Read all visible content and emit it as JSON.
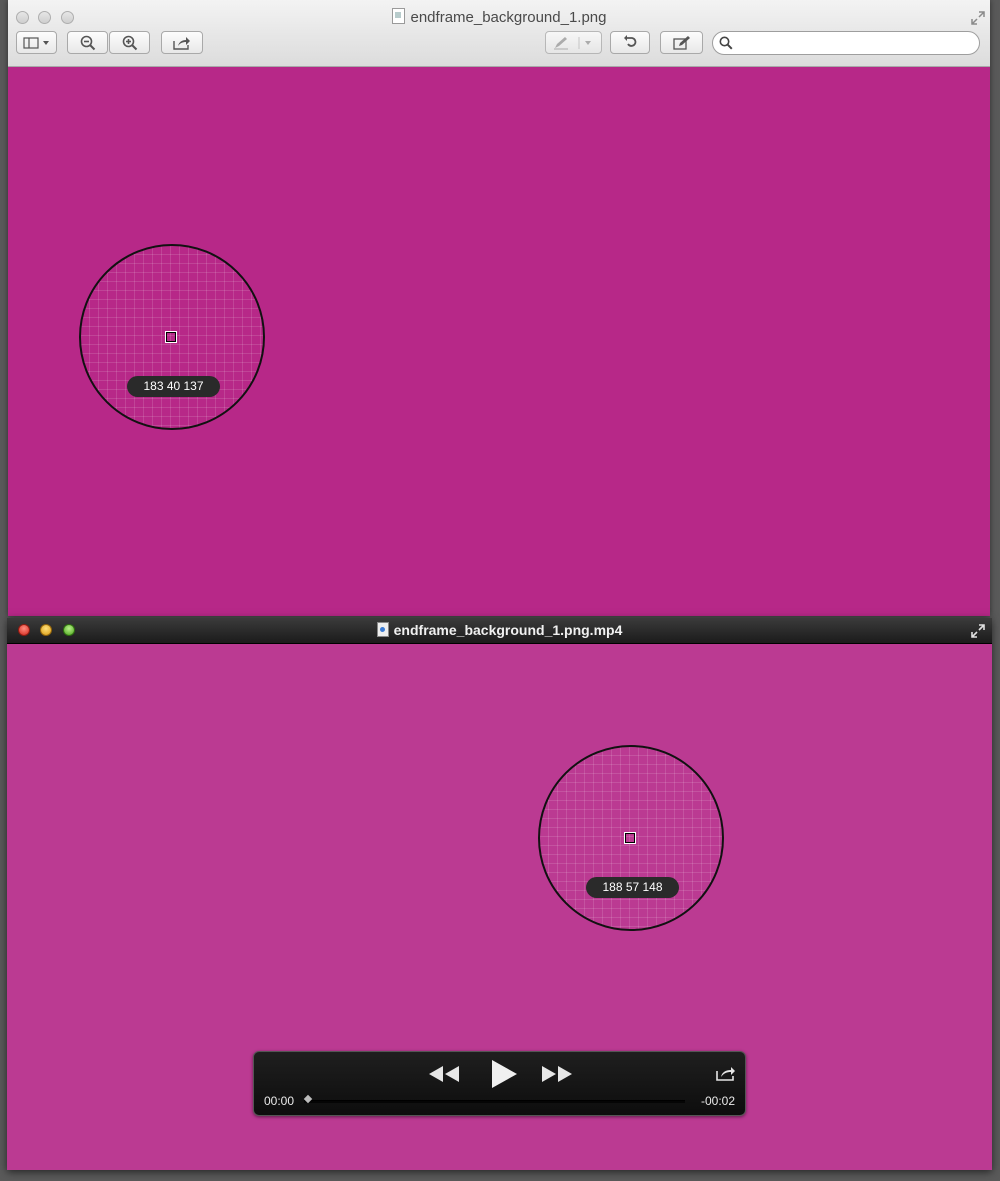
{
  "preview": {
    "title": "endframe_background_1.png",
    "background_color": "#b72888",
    "magnifier": {
      "rgb_readout": "183 40 137"
    },
    "search": {
      "placeholder": "",
      "value": ""
    },
    "toolbar": {
      "sidebar_icon": "sidebar-toggle-icon",
      "zoom_out_icon": "zoom-out-icon",
      "zoom_in_icon": "zoom-in-icon",
      "share_icon": "share-icon",
      "annotate_icon": "pen-icon",
      "rotate_icon": "rotate-icon",
      "edit_icon": "edit-toolbar-icon"
    }
  },
  "quicktime": {
    "title": "endframe_background_1.png.mp4",
    "background_color": "#bb3a92",
    "magnifier": {
      "rgb_readout": "188 57 148"
    },
    "controls": {
      "current_time": "00:00",
      "remaining_time": "-00:02",
      "progress": 0
    }
  }
}
